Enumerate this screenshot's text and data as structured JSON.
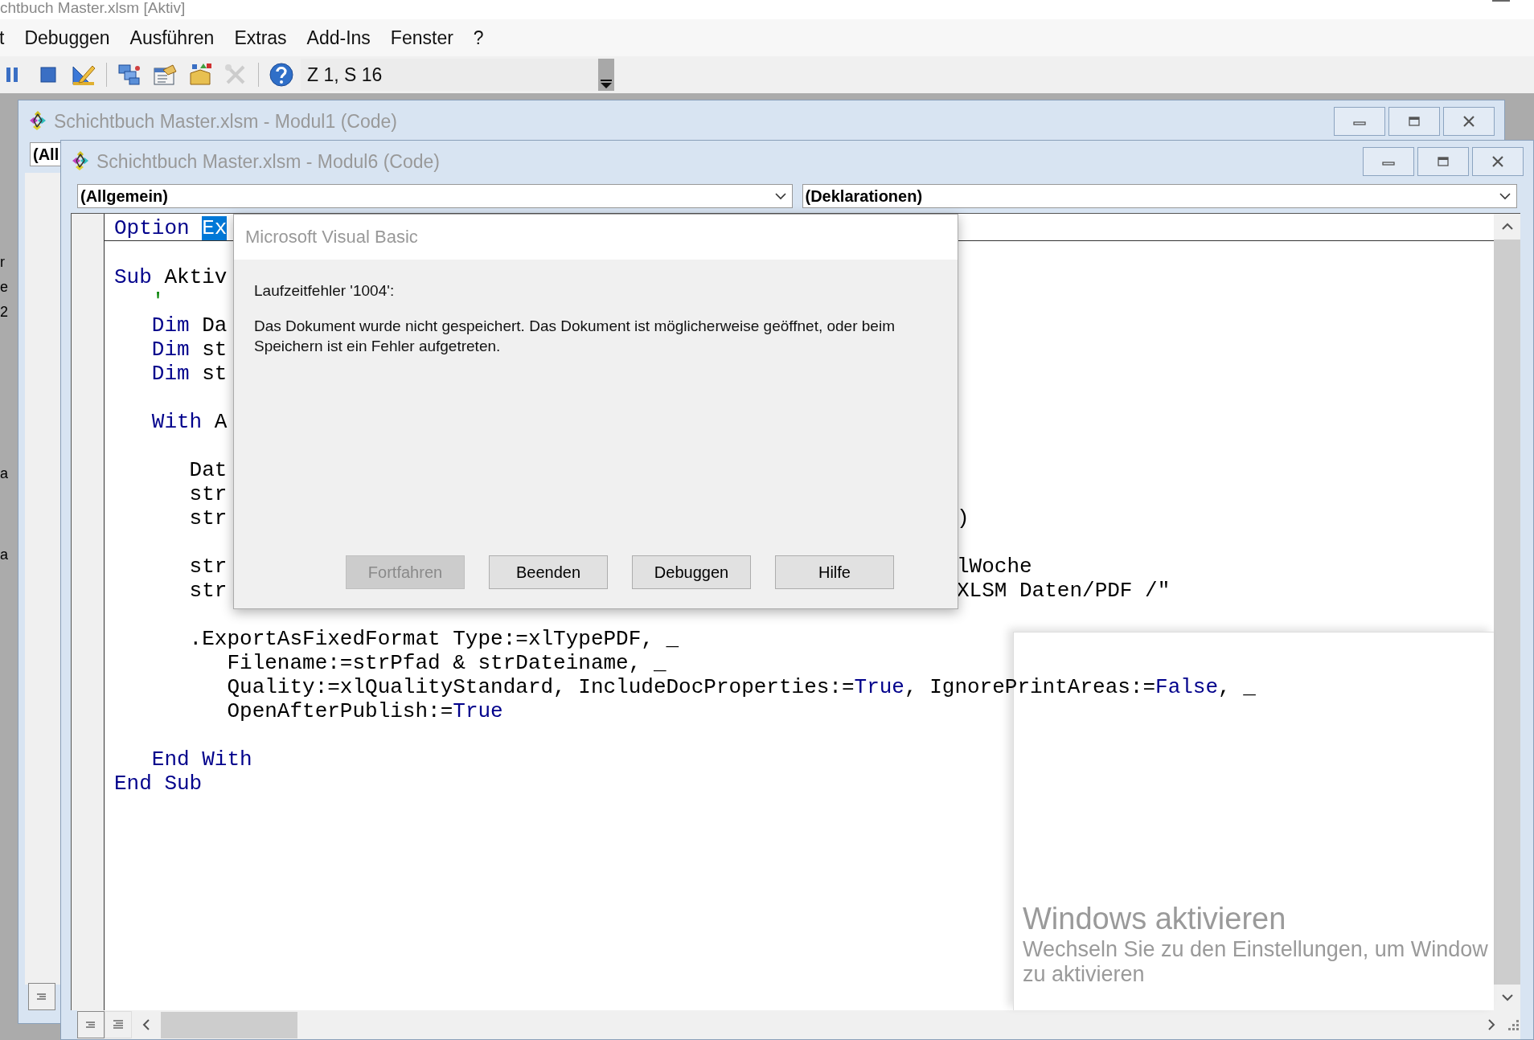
{
  "app_title": "chtbuch Master.xlsm [Aktiv]",
  "menu": [
    "t",
    "Debuggen",
    "Ausführen",
    "Extras",
    "Add-Ins",
    "Fenster",
    "?"
  ],
  "toolbar": {
    "buttons": [
      {
        "kind": "pause",
        "disabled": false
      },
      {
        "kind": "stop",
        "disabled": false
      },
      {
        "kind": "design",
        "disabled": false
      },
      {
        "kind": "explorer",
        "disabled": false
      },
      {
        "kind": "properties",
        "disabled": false
      },
      {
        "kind": "objects",
        "disabled": false
      },
      {
        "kind": "tools",
        "disabled": true
      },
      {
        "kind": "help",
        "disabled": false
      }
    ],
    "position": "Z 1, S 16"
  },
  "left_fragments": [
    "r",
    "e",
    "2",
    "a",
    "a"
  ],
  "back_window": {
    "title": "Schichtbuch Master.xlsm - Modul1 (Code)",
    "object_combo": "(All"
  },
  "code_window": {
    "title": "Schichtbuch Master.xlsm - Modul6 (Code)",
    "object_combo": "(Allgemein)",
    "procedure_combo": "(Deklarationen)",
    "declarations": [
      {
        "kind": "code",
        "tokens": [
          {
            "text": "Option ",
            "kind": "keyword"
          },
          {
            "text": "Ex",
            "kind": "selected"
          }
        ]
      }
    ],
    "procedures": [
      {
        "kind": "blank"
      },
      {
        "kind": "code",
        "tokens": [
          {
            "text": "Sub ",
            "kind": "keyword"
          },
          {
            "text": "Aktiv",
            "kind": "plain"
          }
        ]
      },
      {
        "kind": "code",
        "tokens": [
          {
            "text": "   '",
            "kind": "comment"
          }
        ]
      },
      {
        "kind": "code",
        "tokens": [
          {
            "text": "   Dim ",
            "kind": "keyword"
          },
          {
            "text": "Da",
            "kind": "plain"
          }
        ]
      },
      {
        "kind": "code",
        "tokens": [
          {
            "text": "   Dim ",
            "kind": "keyword"
          },
          {
            "text": "st",
            "kind": "plain"
          }
        ]
      },
      {
        "kind": "code",
        "tokens": [
          {
            "text": "   Dim ",
            "kind": "keyword"
          },
          {
            "text": "st",
            "kind": "plain"
          }
        ]
      },
      {
        "kind": "blank"
      },
      {
        "kind": "code",
        "tokens": [
          {
            "text": "   With ",
            "kind": "keyword"
          },
          {
            "text": "A",
            "kind": "plain"
          }
        ]
      },
      {
        "kind": "blank"
      },
      {
        "kind": "code",
        "tokens": [
          {
            "text": "      Dat",
            "kind": "plain"
          }
        ]
      },
      {
        "kind": "code",
        "tokens": [
          {
            "text": "      str",
            "kind": "plain"
          }
        ]
      },
      {
        "kind": "code",
        "tokens": [
          {
            "text": "      str",
            "kind": "plain"
          }
        ],
        "right": [
          {
            "text": ")",
            "kind": "plain"
          }
        ]
      },
      {
        "kind": "blank"
      },
      {
        "kind": "code",
        "tokens": [
          {
            "text": "      str",
            "kind": "plain"
          }
        ],
        "right": [
          {
            "text": "lWoche",
            "kind": "plain"
          }
        ]
      },
      {
        "kind": "code",
        "tokens": [
          {
            "text": "      str",
            "kind": "plain"
          }
        ],
        "right": [
          {
            "text": "XLSM Daten/PDF /\"",
            "kind": "plain"
          }
        ]
      },
      {
        "kind": "blank"
      },
      {
        "kind": "code",
        "tokens": [
          {
            "text": "      .ExportAsFixedFormat Type:=xlTypePDF, _",
            "kind": "plain"
          }
        ]
      },
      {
        "kind": "code",
        "tokens": [
          {
            "text": "         Filename:=strPfad & strDateiname, _",
            "kind": "plain"
          }
        ]
      },
      {
        "kind": "code",
        "tokens": [
          {
            "text": "         Quality:=xlQualityStandard, IncludeDocProperties:=",
            "kind": "plain"
          },
          {
            "text": "True",
            "kind": "keyword"
          },
          {
            "text": ", IgnorePrintAreas:=",
            "kind": "plain"
          },
          {
            "text": "False",
            "kind": "keyword"
          },
          {
            "text": ", _",
            "kind": "plain"
          }
        ]
      },
      {
        "kind": "code",
        "tokens": [
          {
            "text": "         OpenAfterPublish:=",
            "kind": "plain"
          },
          {
            "text": "True",
            "kind": "keyword"
          }
        ]
      },
      {
        "kind": "blank"
      },
      {
        "kind": "code",
        "tokens": [
          {
            "text": "   End With",
            "kind": "keyword"
          }
        ]
      },
      {
        "kind": "code",
        "tokens": [
          {
            "text": "End Sub",
            "kind": "keyword"
          }
        ]
      }
    ]
  },
  "dialog": {
    "title": "Microsoft Visual Basic",
    "heading": "Laufzeitfehler '1004':",
    "message": "Das Dokument wurde nicht gespeichert. Das Dokument ist möglicherweise geöffnet, oder beim Speichern ist ein Fehler aufgetreten.",
    "buttons": [
      {
        "label": "Fortfahren",
        "disabled": true
      },
      {
        "label": "Beenden",
        "disabled": false
      },
      {
        "label": "Debuggen",
        "disabled": false
      },
      {
        "label": "Hilfe",
        "disabled": false
      }
    ]
  },
  "activation_notice": {
    "title": "Windows aktivieren",
    "lines": [
      "Wechseln Sie zu den Einstellungen, um Window",
      "zu aktivieren"
    ]
  }
}
